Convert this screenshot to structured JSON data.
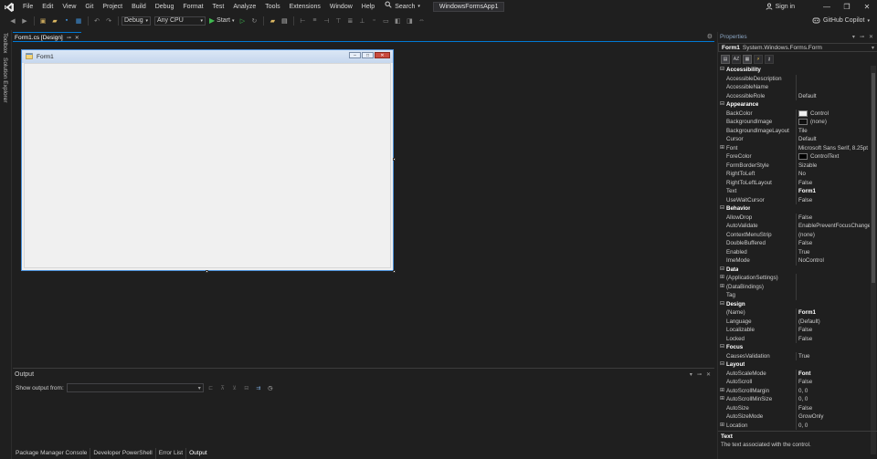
{
  "menu": {
    "items": [
      "File",
      "Edit",
      "View",
      "Git",
      "Project",
      "Build",
      "Debug",
      "Format",
      "Test",
      "Analyze",
      "Tools",
      "Extensions",
      "Window",
      "Help"
    ],
    "search_label": "Search",
    "solution_name": "WindowsFormsApp1",
    "signin_label": "Sign in"
  },
  "toolbar": {
    "config": "Debug",
    "platform": "Any CPU",
    "start_label": "Start",
    "copilot_label": "GitHub Copilot"
  },
  "left_rail": {
    "toolbox": "Toolbox",
    "solution_explorer": "Solution Explorer"
  },
  "document": {
    "tab_label": "Form1.cs [Design]",
    "form_title": "Form1"
  },
  "output": {
    "title": "Output",
    "show_from_label": "Show output from:",
    "show_from_value": ""
  },
  "bottom_tabs": [
    "Package Manager Console",
    "Developer PowerShell",
    "Error List",
    "Output"
  ],
  "properties": {
    "title": "Properties",
    "object_name": "Form1",
    "object_type": "System.Windows.Forms.Form",
    "rows": [
      {
        "kind": "cat",
        "name": "Accessibility"
      },
      {
        "kind": "prop",
        "name": "AccessibleDescription",
        "value": ""
      },
      {
        "kind": "prop",
        "name": "AccessibleName",
        "value": ""
      },
      {
        "kind": "prop",
        "name": "AccessibleRole",
        "value": "Default"
      },
      {
        "kind": "cat",
        "name": "Appearance"
      },
      {
        "kind": "prop",
        "name": "BackColor",
        "value": "Control",
        "swatch": "#f0f0f0"
      },
      {
        "kind": "prop",
        "name": "BackgroundImage",
        "value": "(none)",
        "swatch": "#111111"
      },
      {
        "kind": "prop",
        "name": "BackgroundImageLayout",
        "value": "Tile"
      },
      {
        "kind": "prop",
        "name": "Cursor",
        "value": "Default"
      },
      {
        "kind": "prop",
        "name": "Font",
        "value": "Microsoft Sans Serif, 8.25pt",
        "expand": true
      },
      {
        "kind": "prop",
        "name": "ForeColor",
        "value": "ControlText",
        "swatch": "#000000"
      },
      {
        "kind": "prop",
        "name": "FormBorderStyle",
        "value": "Sizable"
      },
      {
        "kind": "prop",
        "name": "RightToLeft",
        "value": "No"
      },
      {
        "kind": "prop",
        "name": "RightToLeftLayout",
        "value": "False"
      },
      {
        "kind": "prop",
        "name": "Text",
        "value": "Form1",
        "bold": true
      },
      {
        "kind": "prop",
        "name": "UseWaitCursor",
        "value": "False"
      },
      {
        "kind": "cat",
        "name": "Behavior"
      },
      {
        "kind": "prop",
        "name": "AllowDrop",
        "value": "False"
      },
      {
        "kind": "prop",
        "name": "AutoValidate",
        "value": "EnablePreventFocusChange"
      },
      {
        "kind": "prop",
        "name": "ContextMenuStrip",
        "value": "(none)"
      },
      {
        "kind": "prop",
        "name": "DoubleBuffered",
        "value": "False"
      },
      {
        "kind": "prop",
        "name": "Enabled",
        "value": "True"
      },
      {
        "kind": "prop",
        "name": "ImeMode",
        "value": "NoControl"
      },
      {
        "kind": "cat",
        "name": "Data"
      },
      {
        "kind": "prop",
        "name": "(ApplicationSettings)",
        "value": "",
        "expand": true
      },
      {
        "kind": "prop",
        "name": "(DataBindings)",
        "value": "",
        "expand": true
      },
      {
        "kind": "prop",
        "name": "Tag",
        "value": ""
      },
      {
        "kind": "cat",
        "name": "Design"
      },
      {
        "kind": "prop",
        "name": "(Name)",
        "value": "Form1",
        "bold": true
      },
      {
        "kind": "prop",
        "name": "Language",
        "value": "(Default)"
      },
      {
        "kind": "prop",
        "name": "Localizable",
        "value": "False"
      },
      {
        "kind": "prop",
        "name": "Locked",
        "value": "False"
      },
      {
        "kind": "cat",
        "name": "Focus"
      },
      {
        "kind": "prop",
        "name": "CausesValidation",
        "value": "True"
      },
      {
        "kind": "cat",
        "name": "Layout"
      },
      {
        "kind": "prop",
        "name": "AutoScaleMode",
        "value": "Font",
        "bold": true
      },
      {
        "kind": "prop",
        "name": "AutoScroll",
        "value": "False"
      },
      {
        "kind": "prop",
        "name": "AutoScrollMargin",
        "value": "0, 0",
        "expand": true
      },
      {
        "kind": "prop",
        "name": "AutoScrollMinSize",
        "value": "0, 0",
        "expand": true
      },
      {
        "kind": "prop",
        "name": "AutoSize",
        "value": "False"
      },
      {
        "kind": "prop",
        "name": "AutoSizeMode",
        "value": "GrowOnly"
      },
      {
        "kind": "prop",
        "name": "Location",
        "value": "0, 0",
        "expand": true
      }
    ],
    "description_title": "Text",
    "description_text": "The text associated with the control."
  },
  "colors": {
    "accent": "#0078d4",
    "background": "#1f1f1f",
    "form_client": "#f0f0f0"
  }
}
